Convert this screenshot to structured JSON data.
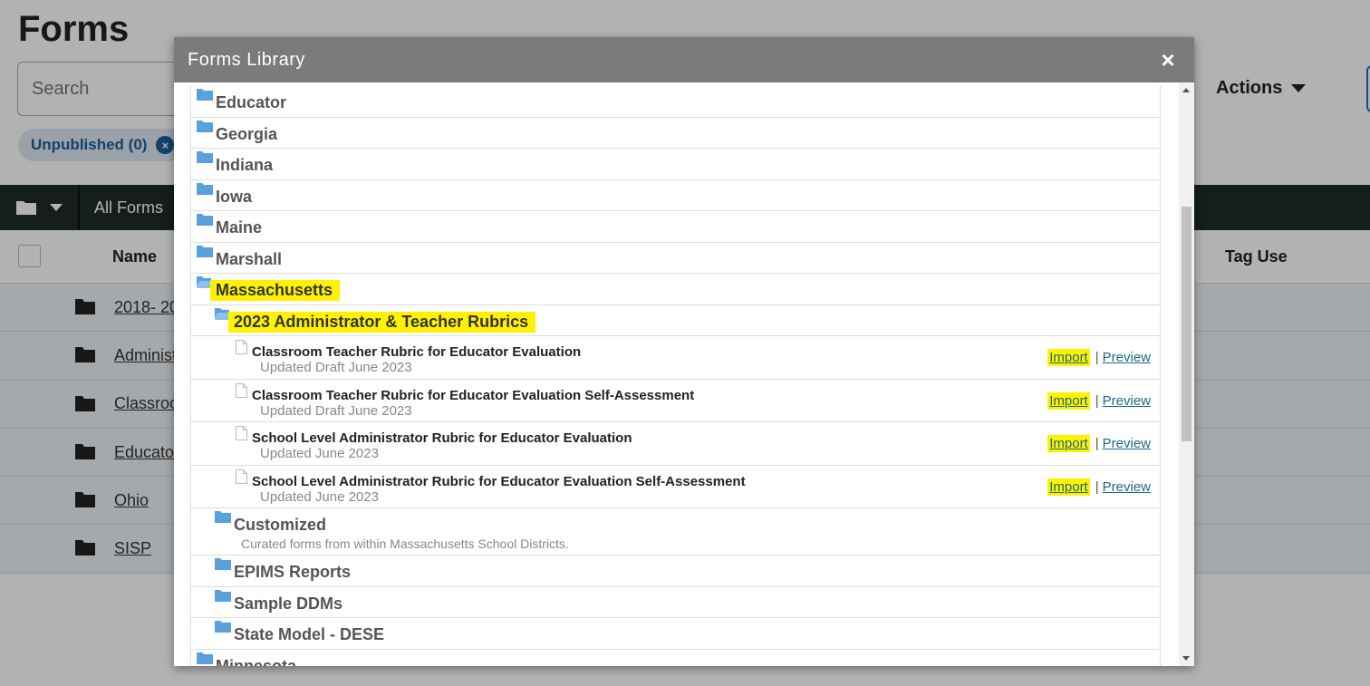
{
  "page": {
    "title": "Forms",
    "search_placeholder": "Search",
    "actions_label": "Actions",
    "chip_label": "Unpublished (0)",
    "chip_close": "×",
    "toolbar_label": "All Forms",
    "col_name": "Name",
    "col_tag_use": "Tag Use",
    "rows": [
      {
        "name": "2018- 20"
      },
      {
        "name": "Administ"
      },
      {
        "name": "Classroo"
      },
      {
        "name": "Educato"
      },
      {
        "name": "Ohio"
      },
      {
        "name": "SISP"
      }
    ]
  },
  "modal": {
    "title": "Forms Library",
    "close": "×",
    "folders_top": [
      "Educator",
      "Georgia",
      "Indiana",
      "Iowa",
      "Maine",
      "Marshall"
    ],
    "open_folder": "Massachusetts",
    "open_subfolder": "2023 Administrator & Teacher Rubrics",
    "forms": [
      {
        "title": "Classroom Teacher Rubric for Educator Evaluation",
        "subtitle": "Updated Draft June 2023"
      },
      {
        "title": "Classroom Teacher Rubric for Educator Evaluation Self-Assessment",
        "subtitle": "Updated Draft June 2023"
      },
      {
        "title": "School Level Administrator Rubric for Educator Evaluation",
        "subtitle": "Updated June 2023"
      },
      {
        "title": "School Level Administrator Rubric for Educator Evaluation Self-Assessment",
        "subtitle": "Updated June 2023"
      }
    ],
    "import_label": "Import",
    "separator": "|",
    "preview_label": "Preview",
    "customized": {
      "label": "Customized",
      "description": "Curated forms from within Massachusetts School Districts."
    },
    "subfolders_after": [
      "EPIMS Reports",
      "Sample DDMs",
      "State Model - DESE"
    ],
    "folders_bottom": [
      "Minnesota"
    ]
  },
  "colors": {
    "highlight": "#fff200",
    "folder_icon": "#5aa0dc",
    "link": "#1b6a88",
    "modal_header": "#7b7b7b",
    "toolbar": "#1f2a2a"
  }
}
